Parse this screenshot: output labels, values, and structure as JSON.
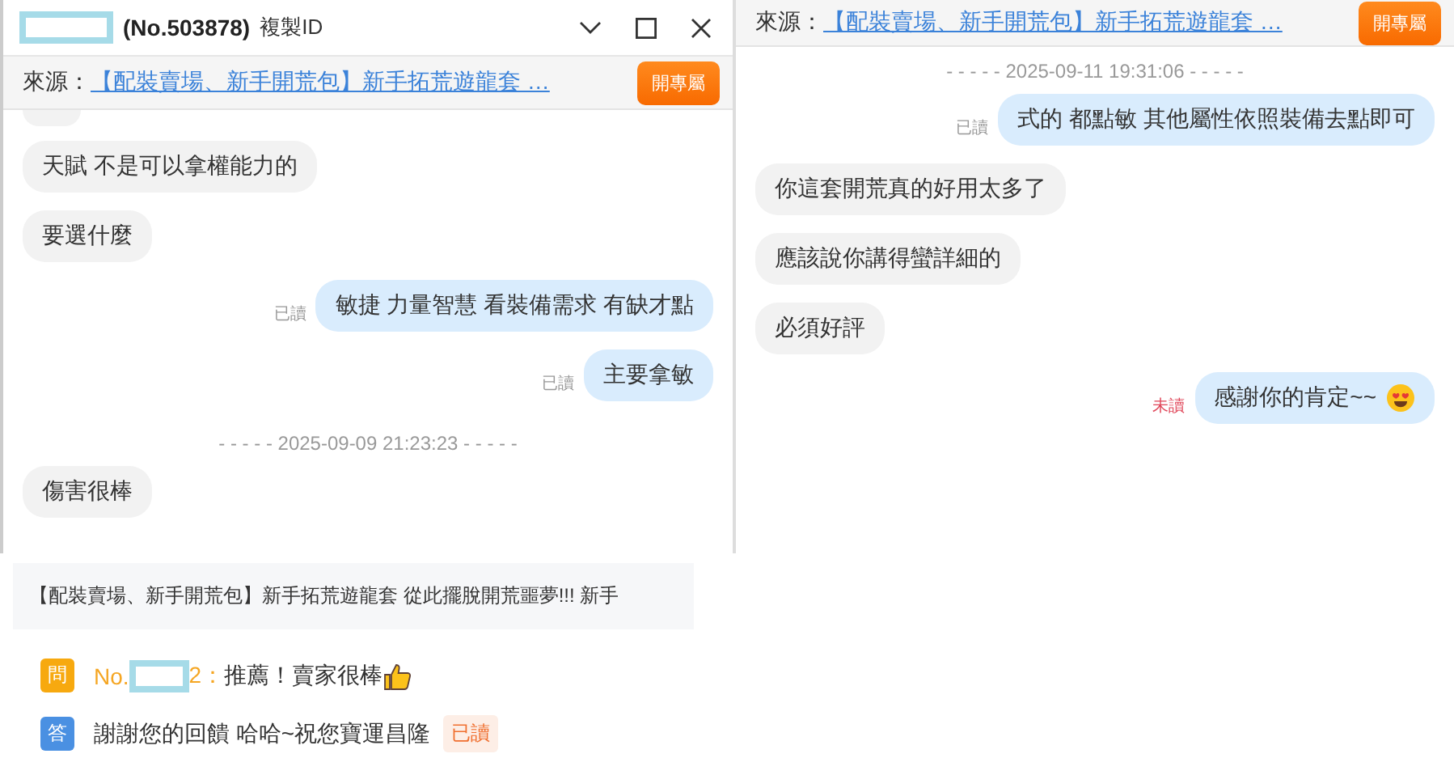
{
  "left_window": {
    "title_suffix": "(No.503878)",
    "copy_id": "複製ID",
    "source_label": "來源：",
    "source_link": "【配裝賣場、新手開荒包】新手拓荒遊龍套 …",
    "open_room_button": "開專屬",
    "messages": [
      {
        "kind": "received",
        "text": "天賦 不是可以拿權能力的"
      },
      {
        "kind": "received",
        "text": "要選什麼"
      },
      {
        "kind": "sent",
        "text": "敏捷 力量智慧 看裝備需求 有缺才點",
        "status": "已讀",
        "read": true
      },
      {
        "kind": "sent",
        "text": "主要拿敏",
        "status": "已讀",
        "read": true
      },
      {
        "kind": "time",
        "text": "- - - - - 2025-09-09 21:23:23 - - - - -"
      },
      {
        "kind": "received",
        "text": "傷害很棒"
      }
    ]
  },
  "right_window": {
    "source_label": "來源：",
    "source_link": "【配裝賣場、新手開荒包】新手拓荒遊龍套 …",
    "open_room_button": "開專屬",
    "messages": [
      {
        "kind": "time",
        "text": "- - - - - 2025-09-11 19:31:06 - - - - -"
      },
      {
        "kind": "sent",
        "text": "式的  都點敏 其他屬性依照裝備去點即可",
        "status": "已讀",
        "read": true
      },
      {
        "kind": "received",
        "text": "你這套開荒真的好用太多了"
      },
      {
        "kind": "received",
        "text": "應該說你講得蠻詳細的"
      },
      {
        "kind": "received",
        "text": "必須好評"
      },
      {
        "kind": "sent",
        "text": "感謝你的肯定~~",
        "emoji": true,
        "status": "未讀",
        "read": false
      }
    ]
  },
  "review": {
    "product_title": "【配裝賣場、新手開荒包】新手拓荒遊龍套 從此擺脫開荒噩夢!!! 新手",
    "items": [
      {
        "kind": "question",
        "badge": "問",
        "user_prefix": "No.",
        "user_suffix": "2：",
        "text": "推薦！賣家很棒",
        "thumbs_up": true
      },
      {
        "kind": "answer",
        "badge": "答",
        "text": "謝謝您的回饋 哈哈~祝您寶運昌隆",
        "status": "已讀"
      }
    ]
  }
}
